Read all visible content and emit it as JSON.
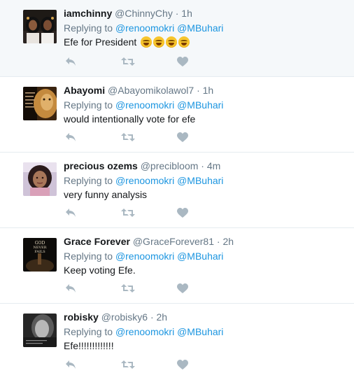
{
  "tweets": [
    {
      "name": "iamchinny",
      "handle": "@ChinnyChy",
      "time": "1h",
      "replying_prefix": "Replying to",
      "mention1": "@renoomokri",
      "mention2": "@MBuhari",
      "text": "Efe for President",
      "emoji": "face-with-tears-of-joy",
      "emoji_count": 4
    },
    {
      "name": "Abayomi",
      "handle": "@Abayomikolawol7",
      "time": "1h",
      "replying_prefix": "Replying to",
      "mention1": "@renoomokri",
      "mention2": "@MBuhari",
      "text": "would intentionally vote for efe"
    },
    {
      "name": "precious ozems",
      "handle": "@precibloom",
      "time": "4m",
      "replying_prefix": "Replying to",
      "mention1": "@renoomokri",
      "mention2": "@MBuhari",
      "text": "very funny analysis"
    },
    {
      "name": "Grace Forever",
      "handle": "@GraceForever81",
      "time": "2h",
      "replying_prefix": "Replying to",
      "mention1": "@renoomokri",
      "mention2": "@MBuhari",
      "text": "Keep voting Efe.",
      "avatar_text_1": "GOD",
      "avatar_text_2": "NEVER",
      "avatar_text_3": "FAILS"
    },
    {
      "name": "robisky",
      "handle": "@robisky6",
      "time": "2h",
      "replying_prefix": "Replying to",
      "mention1": "@renoomokri",
      "mention2": "@MBuhari",
      "text": "Efe!!!!!!!!!!!!!"
    }
  ],
  "dot": "·",
  "icons": {
    "reply": "reply-icon",
    "retweet": "retweet-icon",
    "like": "heart-icon"
  },
  "colors": {
    "link": "#1b95e0",
    "muted": "#657786",
    "icon": "#aab8c2",
    "highlight_bg": "#f5f8fa"
  }
}
